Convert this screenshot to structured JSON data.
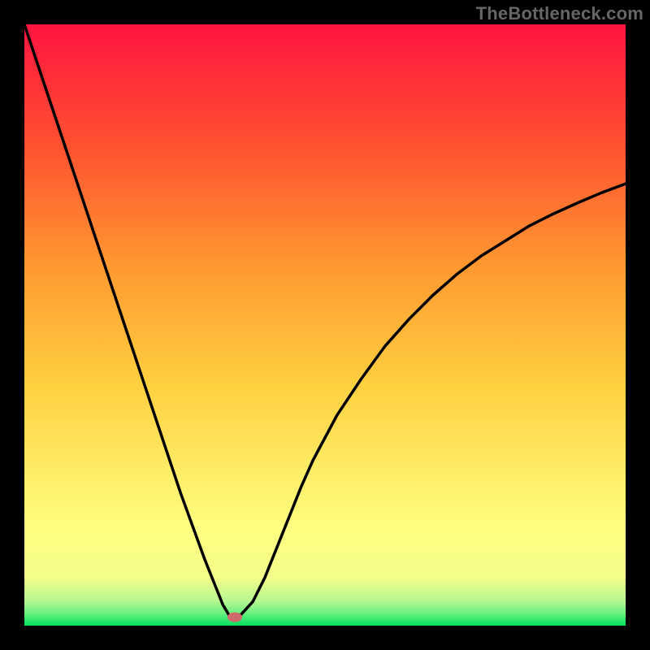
{
  "watermark": "TheBottleneck.com",
  "chart_data": {
    "type": "line",
    "title": "",
    "xlabel": "",
    "ylabel": "",
    "xlim": [
      0,
      100
    ],
    "ylim": [
      0,
      100
    ],
    "background": {
      "type": "vertical_gradient",
      "stops": [
        {
          "offset": 0.0,
          "color": "#00e060"
        },
        {
          "offset": 0.02,
          "color": "#6af080"
        },
        {
          "offset": 0.04,
          "color": "#b5f790"
        },
        {
          "offset": 0.08,
          "color": "#f3fe8a"
        },
        {
          "offset": 0.16,
          "color": "#ffff80"
        },
        {
          "offset": 0.4,
          "color": "#ffd040"
        },
        {
          "offset": 0.6,
          "color": "#ff9830"
        },
        {
          "offset": 0.8,
          "color": "#ff5030"
        },
        {
          "offset": 1.0,
          "color": "#ff1440"
        }
      ]
    },
    "series": [
      {
        "name": "bottleneck-curve",
        "color": "#000000",
        "x": [
          0,
          2,
          4,
          6,
          8,
          10,
          12,
          14,
          16,
          18,
          20,
          22,
          24,
          26,
          28,
          30,
          32,
          33,
          34,
          35,
          36,
          38,
          40,
          42,
          44,
          46,
          48,
          52,
          56,
          60,
          64,
          68,
          72,
          76,
          80,
          84,
          88,
          92,
          96,
          100
        ],
        "y": [
          100,
          94,
          88,
          82,
          76,
          70,
          64,
          58,
          52,
          46,
          40,
          34,
          28,
          22,
          16.5,
          11,
          6,
          3.5,
          1.8,
          1.4,
          1.8,
          4,
          8,
          13,
          18,
          23,
          27.5,
          35,
          41,
          46.5,
          51,
          55,
          58.5,
          61.5,
          64,
          66.5,
          68.5,
          70.3,
          72,
          73.5
        ]
      }
    ],
    "marker": {
      "name": "optimum-marker",
      "x": 35,
      "y": 1.4,
      "color": "#cf6b6b",
      "rx": 9,
      "ry": 6
    }
  }
}
